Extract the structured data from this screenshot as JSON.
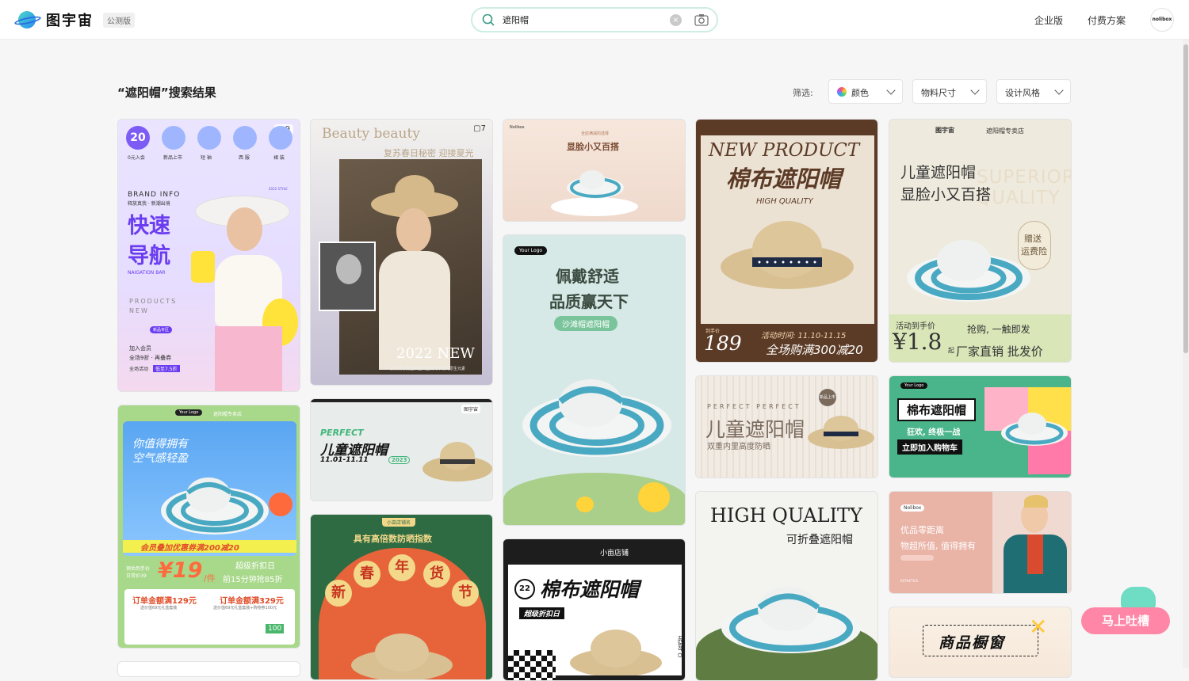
{
  "header": {
    "logo_text": "图宇宙",
    "beta_label": "公测版",
    "search": {
      "value": "遮阳帽",
      "placeholder": ""
    },
    "nav": {
      "enterprise": "企业版",
      "pricing": "付费方案"
    },
    "avatar_label": "nolibox"
  },
  "results": {
    "title": "“遮阳帽”搜索结果",
    "filter_label": "筛选:",
    "filters": {
      "color": "颜色",
      "size": "物料尺寸",
      "style": "设计风格"
    }
  },
  "cards": {
    "c1": {
      "pages": "9",
      "date_num": "20",
      "cats": [
        "0元入会",
        "新品上市",
        "短 袖",
        "西 服",
        "裙 装"
      ],
      "brand": "BRAND INFO",
      "sub": "释放真我 · 新潮出境",
      "h1": "快速",
      "h2": "导航",
      "nav": "NAIGATION BAR",
      "prod": "PRODUCTS",
      "new": "NEW",
      "tag": "新品专区",
      "m1": "加入会员",
      "m2": "全场9折 · 再叠券",
      "m3": "全场活动",
      "m4": "低至7.5折",
      "year_style": "2022 STYLE"
    },
    "c2": {
      "pages": "7",
      "script": "Beauty beauty",
      "sub": "复苏春日秘密 迎接夏光",
      "year": "2022 NEW",
      "fine": "我们精心挑选来自大自然的丰收的原生元素"
    },
    "c3": {
      "brand": "Nolibox",
      "top": "全店满减的选择",
      "title": "显脸小又百搭"
    },
    "c4": {
      "en1": "NEW PRODUCT",
      "cn": "棉布遮阳帽",
      "script": "HIGH QUALITY",
      "label": "到手价",
      "price": "189",
      "event": "活动时间: 11.10-11.15",
      "promo": "全场购满300减20"
    },
    "c5": {
      "brand": "图宇宙",
      "shop": "遮阳帽专卖店",
      "l1": "儿童遮阳帽",
      "l2": "显脸小又百搭",
      "bg": "SUPERIOR QUALITY",
      "badge1": "赠送",
      "badge2": "运费险",
      "p_label": "活动到手价",
      "price": "¥1.8",
      "unit": "起",
      "t1": "抢购, 一触即发",
      "t2": "厂家直销 批发价"
    },
    "c6": {
      "logo": "Your Logo",
      "l1": "佩戴舒适",
      "l2": "品质赢天下",
      "pill": "沙滩帽遮阳帽"
    },
    "c7": {
      "logo": "Your Logo",
      "shop": "遮阳帽专卖店",
      "l1": "你值得拥有",
      "l2": "空气感轻盈",
      "bar": "会员叠加优惠券满200减20",
      "pre": "预估到手价",
      "price_old": "日常价39",
      "price": "¥19",
      "unit": "/件",
      "hot": "超级折扣日",
      "hot2": "前15分钟抢85折",
      "o1": "订单金额满129元",
      "o1s": "送价值69元礼盒套装",
      "o2": "订单金额满329元",
      "o2s": "送价值69元礼盒套装+购物券100元",
      "coupon": "100"
    },
    "c8": {
      "brand": "图宇宙",
      "en": "PERFECT",
      "cn": "儿童遮阳帽",
      "date": "11.01-11.11",
      "year": "2023"
    },
    "c9": {
      "en": "PERFECT PERFECT",
      "cn": "儿童遮阳帽",
      "sub": "双重内里高度防晒",
      "badge": "新品上市"
    },
    "c10": {
      "brand": "Your Logo",
      "title": "棉布遮阳帽",
      "t1": "狂欢, 终极一战",
      "t2": "立即加入购物车"
    },
    "c11": {
      "shop": "小亩店铺名",
      "title": "具有高倍数防晒指数",
      "chars": [
        "新",
        "春",
        "年",
        "货",
        "节"
      ]
    },
    "c12": {
      "brand": "Nolibox",
      "t1": "优品零距离",
      "t2": "物超所值, 值得拥有",
      "small": "ESTHETICS"
    },
    "c13": {
      "shop": "小亩店铺",
      "year": "22",
      "title": "棉布遮阳帽",
      "tag": "超级折扣日",
      "side": "HEART CI"
    },
    "c14": {
      "en": "HIGH QUALITY",
      "cn": "可折叠遮阳帽"
    },
    "c15": {
      "title": "商品橱窗"
    }
  },
  "float_feedback": "马上吐槽"
}
